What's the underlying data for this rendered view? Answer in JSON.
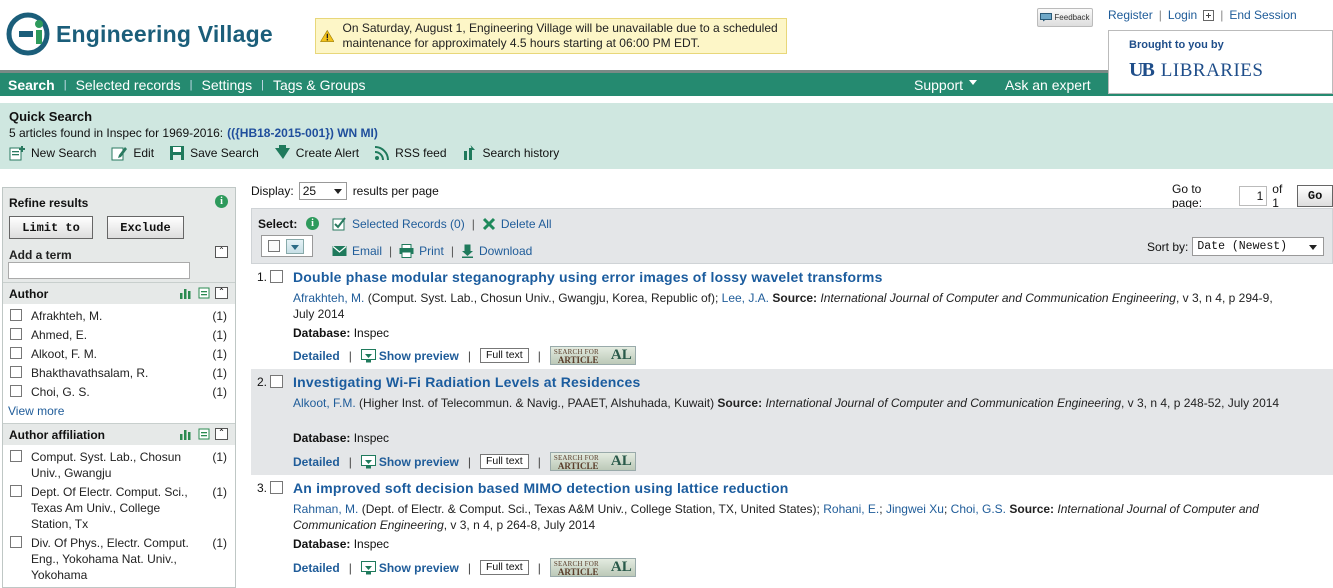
{
  "brand": {
    "name": "Engineering Village",
    "logo_letter": "E",
    "colors": {
      "brand_blue": "#1b5e7a",
      "nav_green": "#258a70",
      "link": "#1f5c99",
      "band": "#cfe7e0"
    }
  },
  "alert": {
    "icon": "warning-icon",
    "text": "On Saturday, August 1, Engineering Village will be unavailable due to a scheduled maintenance for approximately 4.5 hours starting at 06:00 PM EDT."
  },
  "topbar": {
    "feedback_label": "Feedback",
    "register": "Register",
    "login": "Login",
    "end_session": "End Session",
    "brought_to_you_by": "Brought to you by",
    "institution_mark": "UB",
    "institution_name": "LIBRARIES"
  },
  "nav": {
    "items": [
      {
        "label": "Search",
        "active": true
      },
      {
        "label": "Selected records"
      },
      {
        "label": "Settings"
      },
      {
        "label": "Tags & Groups"
      }
    ],
    "support": "Support",
    "ask_expert": "Ask an expert"
  },
  "quick_search": {
    "title": "Quick Search",
    "summary": "5 articles found in Inspec for 1969-2016:",
    "query": "(({HB18-2015-001}) WN MI)",
    "actions": [
      {
        "label": "New Search",
        "icon": "new-search-icon"
      },
      {
        "label": "Edit",
        "icon": "edit-icon"
      },
      {
        "label": "Save Search",
        "icon": "save-icon"
      },
      {
        "label": "Create Alert",
        "icon": "alert-icon"
      },
      {
        "label": "RSS feed",
        "icon": "rss-icon"
      },
      {
        "label": "Search history",
        "icon": "history-icon"
      }
    ]
  },
  "sidebar": {
    "title": "Refine results",
    "limit_to": "Limit to",
    "exclude": "Exclude",
    "add_term": "Add a term",
    "author": {
      "title": "Author",
      "items": [
        {
          "name": "Afrakhteh, M.",
          "count": "(1)"
        },
        {
          "name": "Ahmed, E.",
          "count": "(1)"
        },
        {
          "name": "Alkoot, F. M.",
          "count": "(1)"
        },
        {
          "name": "Bhakthavathsalam, R.",
          "count": "(1)"
        },
        {
          "name": "Choi, G. S.",
          "count": "(1)"
        }
      ],
      "view_more": "View more"
    },
    "affiliation": {
      "title": "Author affiliation",
      "items": [
        {
          "name": "Comput. Syst. Lab., Chosun Univ., Gwangju",
          "count": "(1)"
        },
        {
          "name": "Dept. Of Electr. Comput. Sci., Texas Am Univ., College Station, Tx",
          "count": "(1)"
        },
        {
          "name": "Div. Of Phys., Electr. Comput. Eng., Yokohama Nat. Univ., Yokohama",
          "count": "(1)"
        }
      ]
    }
  },
  "results_controls": {
    "display_label": "Display:",
    "per_page": "25",
    "per_page_suffix": "results per page",
    "goto_label": "Go to page:",
    "goto_value": "1",
    "of_label": "of 1",
    "go": "Go",
    "select_label": "Select:",
    "selected_records": "Selected Records (0)",
    "delete_all": "Delete All",
    "email": "Email",
    "print": "Print",
    "download": "Download",
    "sort_label": "Sort by:",
    "sort_value": "Date (Newest)"
  },
  "results": [
    {
      "num": "1.",
      "title": "Double phase modular steganography using error images of lossy wavelet transforms",
      "authors": [
        {
          "name": "Afrakhteh, M.",
          "aff": " (Comput. Syst. Lab., Chosun Univ., Gwangju, Korea, Republic of); "
        },
        {
          "name": "Lee, J.A.",
          "aff": " "
        }
      ],
      "source_label": "Source:",
      "journal": "International Journal of Computer and Communication Engineering",
      "details": ", v 3, n 4, p 294-9, July 2014",
      "database_label": "Database:",
      "database": "Inspec"
    },
    {
      "num": "2.",
      "title": "Investigating Wi-Fi Radiation Levels at Residences",
      "authors": [
        {
          "name": "Alkoot, F.M.",
          "aff": " (Higher Inst. of Telecommun. & Navig., PAAET, Alshuhada, Kuwait) "
        }
      ],
      "source_label": "Source:",
      "journal": "International Journal of Computer and Communication Engineering",
      "details": ", v 3, n 4, p 248-52, July 2014",
      "database_label": "Database:",
      "database": "Inspec"
    },
    {
      "num": "3.",
      "title": "An improved soft decision based MIMO detection using lattice reduction",
      "authors": [
        {
          "name": "Rahman, M.",
          "aff": " (Dept. of Electr. & Comput. Sci., Texas A&M Univ., College Station, TX, United States); "
        },
        {
          "name": "Rohani, E.",
          "aff": "; "
        },
        {
          "name": "Jingwei Xu",
          "aff": "; "
        },
        {
          "name": "Choi, G.S.",
          "aff": " "
        }
      ],
      "source_label": "Source:",
      "journal": "International Journal of Computer and Communication Engineering",
      "details": ", v 3, n 4, p 264-8, July 2014",
      "database_label": "Database:",
      "database": "Inspec"
    }
  ],
  "result_actions": {
    "detailed": "Detailed",
    "show_preview": "Show preview",
    "full_text": "Full text",
    "search_for": "SEARCH FOR",
    "article": "ARTICLE",
    "al": "AL"
  }
}
